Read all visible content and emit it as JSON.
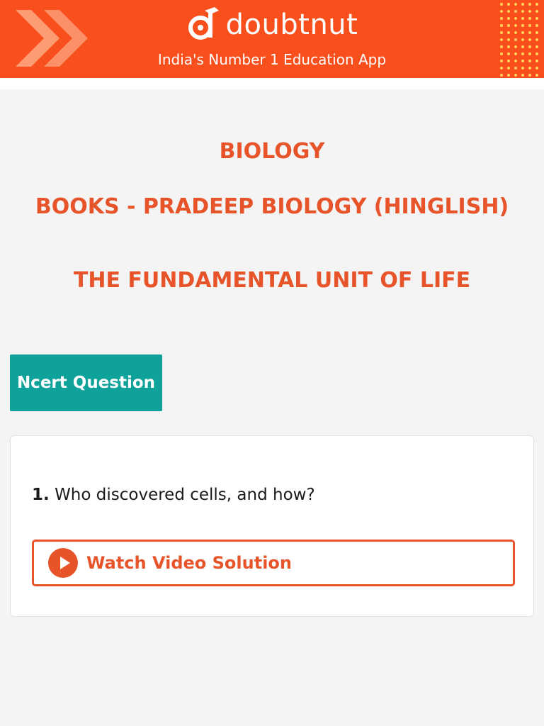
{
  "header": {
    "brand": "doubtnut",
    "tagline": "India's Number 1 Education App",
    "logo_icon": "doubtnut-logo-icon"
  },
  "titles": {
    "subject": "BIOLOGY",
    "book": "BOOKS - PRADEEP BIOLOGY (HINGLISH)",
    "chapter": "THE FUNDAMENTAL UNIT OF LIFE"
  },
  "section": {
    "label": "Ncert Question"
  },
  "question": {
    "number": "1.",
    "text": "Who discovered cells, and how?",
    "action_label": "Watch Video Solution",
    "action_icon": "play-icon"
  },
  "colors": {
    "brand_orange": "#f84f1c",
    "title_orange": "#e8542a",
    "teal": "#0fa29a"
  }
}
